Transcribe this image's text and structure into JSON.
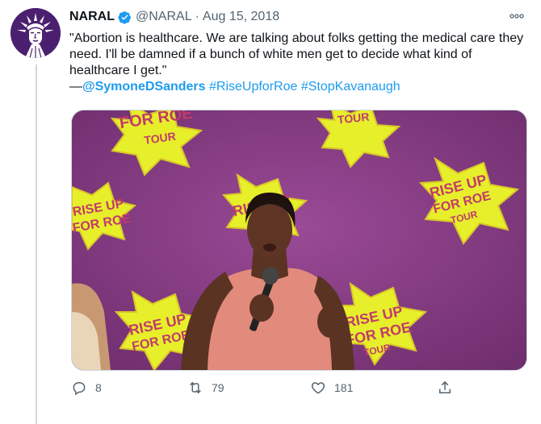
{
  "tweet": {
    "author_name": "NARAL",
    "handle": "@NARAL",
    "separator": "·",
    "date": "Aug 15, 2018",
    "text": "\"Abortion is healthcare. We are talking about folks getting the medical care they need. I'll be damned if a bunch of white men get to decide what kind of healthcare I get.\"",
    "attribution_dash": "—",
    "mention": "@SymoneDSanders",
    "hashtags": [
      "#RiseUpforRoe",
      "#StopKavanaugh"
    ]
  },
  "media": {
    "banner_text": [
      "RISE UP",
      "FOR ROE",
      "TOUR"
    ]
  },
  "actions": {
    "reply_count": "8",
    "retweet_count": "79",
    "like_count": "181"
  },
  "icons": {
    "avatar": "statue-of-liberty-icon",
    "verified": "verified-badge-icon",
    "more": "more-icon",
    "reply": "reply-icon",
    "retweet": "retweet-icon",
    "like": "heart-icon",
    "share": "share-icon"
  },
  "colors": {
    "link": "#1d9bf0",
    "muted": "#536471",
    "avatar_bg": "#4b1f6f",
    "media_bg": "#8a3f86",
    "sign_yellow": "#e9f02a"
  }
}
